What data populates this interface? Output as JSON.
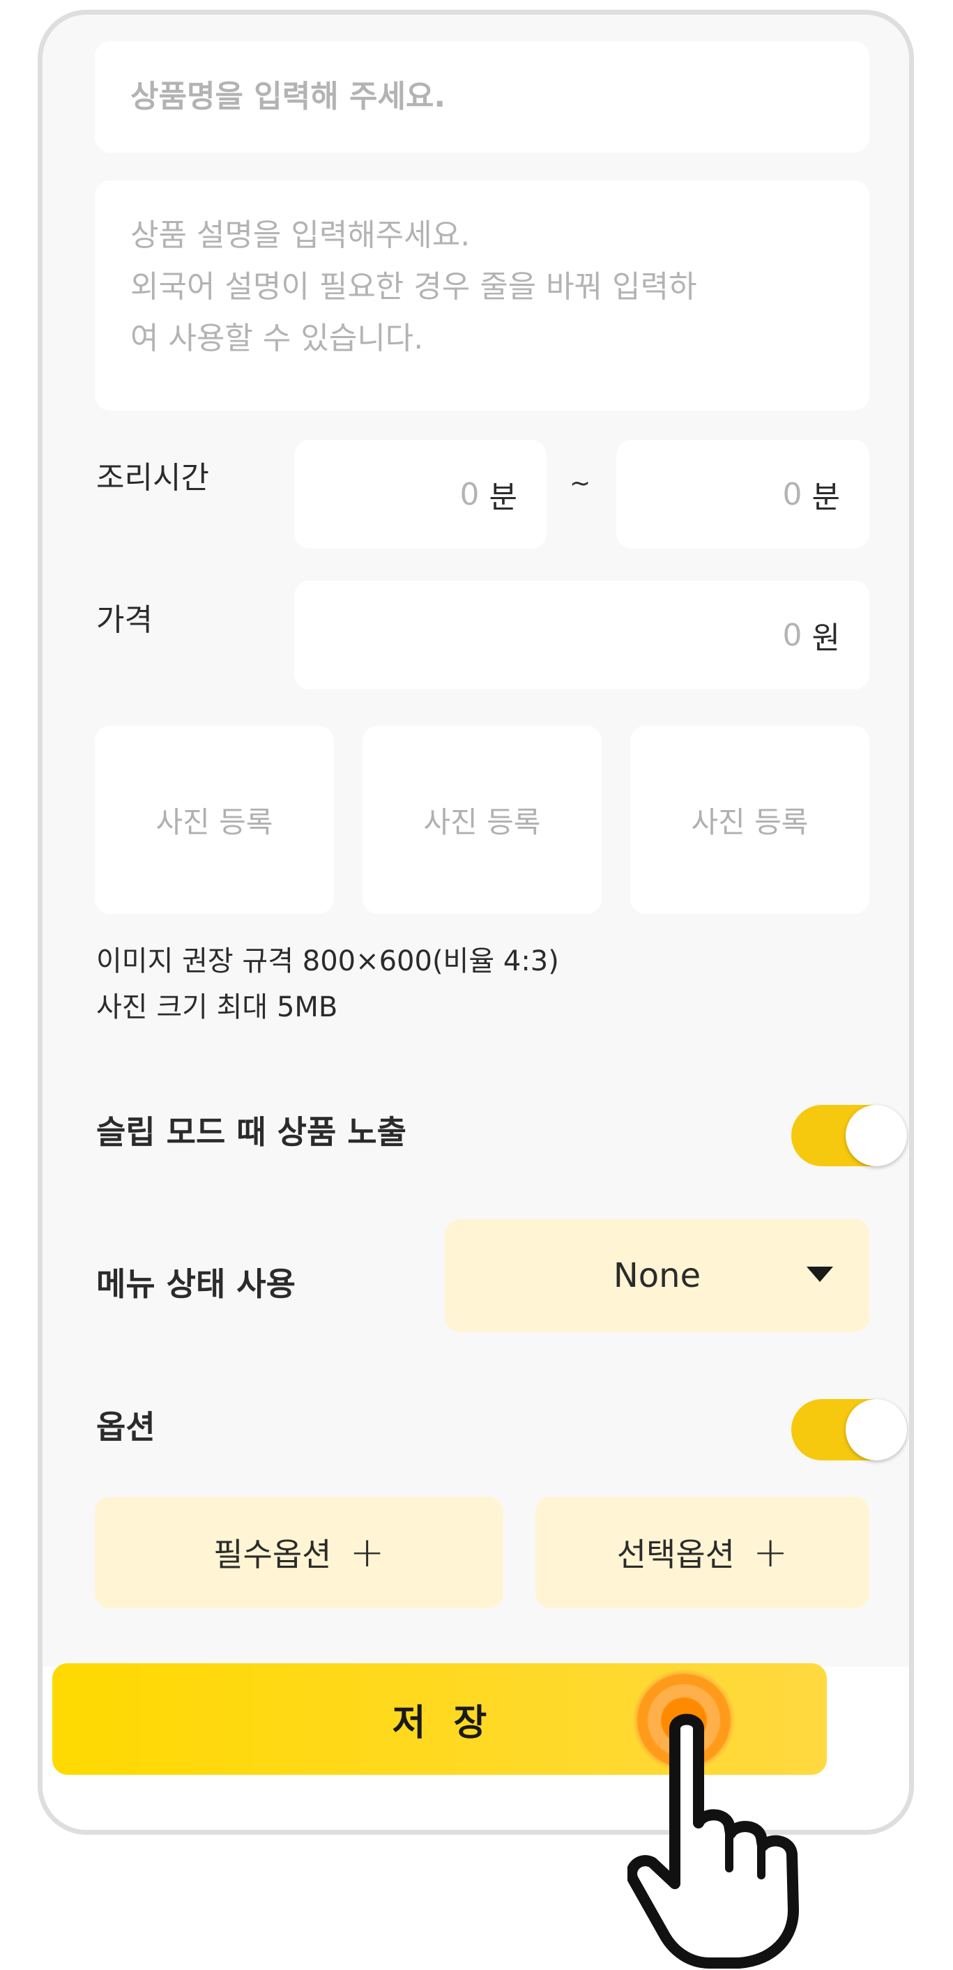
{
  "form": {
    "name_placeholder": "상품명을 입력해 주세요.",
    "desc_placeholder": "상품 설명을 입력해주세요.\n외국어 설명이 필요한 경우 줄을 바꿔 입력하\n여 사용할 수 있습니다.",
    "cook_time": {
      "label": "조리시간",
      "min_value": "0",
      "max_value": "0",
      "unit": "분",
      "separator": "~"
    },
    "price": {
      "label": "가격",
      "value": "0",
      "unit": "원"
    },
    "photos": [
      "사진 등록",
      "사진 등록",
      "사진 등록"
    ],
    "image_note_line1": "이미지 권장 규격 800×600(비율 4:3)",
    "image_note_line2": "사진 크기 최대 5MB",
    "slip_mode": {
      "label": "슬립 모드 때 상품 노출",
      "enabled": true
    },
    "menu_status": {
      "label": "메뉴 상태 사용",
      "selected": "None"
    },
    "options": {
      "label": "옵션",
      "enabled": true,
      "required_button": "필수옵션",
      "optional_button": "선택옵션",
      "plus_glyph": "+"
    },
    "save_button": "저장"
  },
  "colors": {
    "accent": "#f6c90e",
    "button_bg": "#fff5d4",
    "save_bg": "#ffd900",
    "tap_ring": "#ff8a00"
  },
  "icons": [
    "chevron-down-icon",
    "plus-icon",
    "pointing-hand-icon"
  ]
}
